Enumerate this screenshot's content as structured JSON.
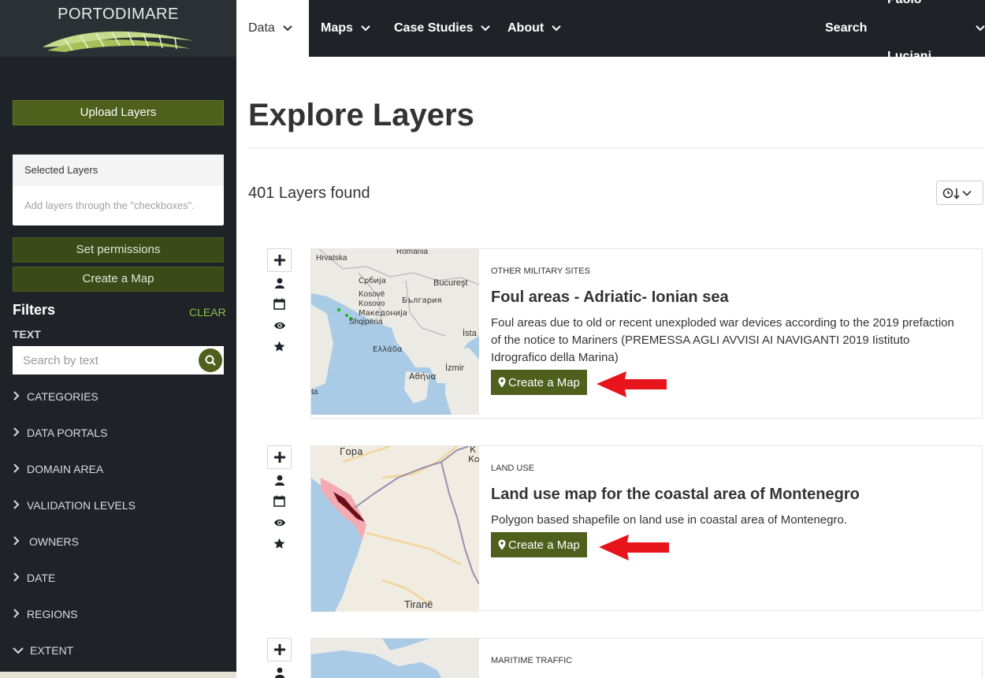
{
  "brand": {
    "name": "PORTODIMARE"
  },
  "nav": {
    "items": [
      {
        "label": "Data"
      },
      {
        "label": "Maps"
      },
      {
        "label": "Case Studies"
      },
      {
        "label": "About"
      }
    ],
    "search_label": "Search",
    "user_label": "Paolo Luciani"
  },
  "sidebar": {
    "upload_label": "Upload Layers",
    "selected_title": "Selected Layers",
    "selected_hint": "Add layers through the \"checkboxes\".",
    "set_permissions_label": "Set permissions",
    "create_map_label": "Create a Map",
    "filters_title": "Filters",
    "clear_label": "CLEAR",
    "text_label": "TEXT",
    "search_placeholder": "Search by text",
    "filters": [
      {
        "label": "CATEGORIES",
        "expanded": false
      },
      {
        "label": "DATA PORTALS",
        "expanded": false
      },
      {
        "label": "DOMAIN AREA",
        "expanded": false
      },
      {
        "label": "VALIDATION LEVELS",
        "expanded": false
      },
      {
        "label": "OWNERS",
        "expanded": false
      },
      {
        "label": "DATE",
        "expanded": false
      },
      {
        "label": "REGIONS",
        "expanded": false
      },
      {
        "label": "EXTENT",
        "expanded": true
      }
    ]
  },
  "main": {
    "page_title": "Explore Layers",
    "results_count": "401 Layers found",
    "layers": [
      {
        "category": "OTHER MILITARY SITES",
        "title": "Foul areas - Adriatic- Ionian sea",
        "description": "Foul areas due to old or recent unexploded war devices according to the 2019 prefaction of the notice to Mariners (PREMESSA AGLI AVVISI AI NAVIGANTI 2019 Iistituto Idrografico della Marina)",
        "button_label": "Create a Map",
        "map_labels": [
          "Hrvatska",
          "Romania",
          "Србија",
          "Bucureşt",
          "Kosovë",
          "Kosovo",
          "България",
          "Македонија",
          "Shqipëria",
          "Ελλάδα",
          "İsta",
          "İzmir",
          "Αθήνα",
          "ta"
        ]
      },
      {
        "category": "LAND USE",
        "title": "Land use map for the coastal area of Montenegro",
        "description": "Polygon based shapefile on land use in coastal area of Montenegro.",
        "button_label": "Create a Map",
        "map_labels": [
          "Гора",
          "К",
          "Ко",
          "Tiranë"
        ]
      },
      {
        "category": "MARITIME TRAFFIC",
        "title": "",
        "description": "",
        "button_label": "",
        "map_labels": []
      }
    ]
  },
  "colors": {
    "sidebar_bg": "#1f2327",
    "brand_olive": "#4f5f1c",
    "clear_green": "#8bc34a",
    "annotation_red": "#e8141c"
  },
  "icons": [
    "plus-icon",
    "user-icon",
    "calendar-icon",
    "eye-icon",
    "star-icon",
    "search-icon",
    "map-marker-icon",
    "clock-icon",
    "chevron-right-icon",
    "chevron-down-icon",
    "sort-icon"
  ]
}
